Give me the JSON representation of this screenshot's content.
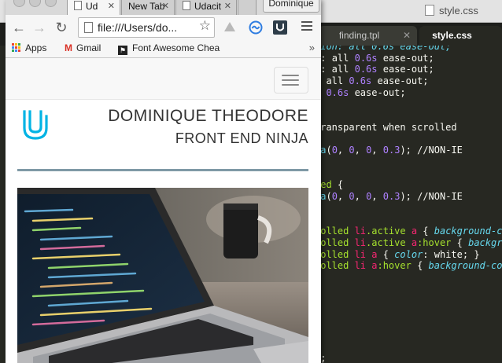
{
  "editor": {
    "title": "style.css",
    "tabs": [
      {
        "label": "finding.tpl",
        "active": false
      },
      {
        "label": "style.css",
        "active": true
      }
    ],
    "code_lines": [
      {
        "parts": [
          [
            "c-prop",
            "tion: all 0.6s ease-out;"
          ]
        ]
      },
      {
        "parts": [
          [
            "c-prop",
            "n"
          ],
          [
            "c-white",
            ": "
          ],
          [
            "c-white",
            "all "
          ],
          [
            "c-num",
            "0.6s"
          ],
          [
            "c-white",
            " ease-out;"
          ]
        ]
      },
      {
        "parts": [
          [
            "c-prop",
            "n"
          ],
          [
            "c-white",
            ": all "
          ],
          [
            "c-num",
            "0.6s"
          ],
          [
            "c-white",
            " ease-out;"
          ]
        ]
      },
      {
        "parts": [
          [
            "c-white",
            ": all "
          ],
          [
            "c-num",
            "0.6s"
          ],
          [
            "c-white",
            " ease-out;"
          ]
        ]
      },
      {
        "parts": [
          [
            "c-white",
            "l "
          ],
          [
            "c-num",
            "0.6s"
          ],
          [
            "c-white",
            " ease-out;"
          ]
        ]
      },
      {
        "parts": [
          [
            "c-white",
            ""
          ]
        ]
      },
      {
        "parts": [
          [
            "c-white",
            ""
          ]
        ]
      },
      {
        "parts": [
          [
            "c-cm",
            "transparent when scrolled"
          ]
        ]
      },
      {
        "parts": [
          [
            "c-white",
            ""
          ]
        ]
      },
      {
        "parts": [
          [
            "c-fn",
            "pa"
          ],
          [
            "c-white",
            "("
          ],
          [
            "c-num",
            "0"
          ],
          [
            "c-white",
            ", "
          ],
          [
            "c-num",
            "0"
          ],
          [
            "c-white",
            ", "
          ],
          [
            "c-num",
            "0"
          ],
          [
            "c-white",
            ", "
          ],
          [
            "c-num",
            "0.3"
          ],
          [
            "c-white",
            "); //NON-IE"
          ]
        ]
      },
      {
        "parts": [
          [
            "c-white",
            ""
          ]
        ]
      },
      {
        "parts": [
          [
            "c-white",
            ""
          ]
        ]
      },
      {
        "parts": [
          [
            "c-green",
            "led"
          ],
          [
            "c-white",
            " {"
          ]
        ]
      },
      {
        "parts": [
          [
            "c-fn",
            "pa"
          ],
          [
            "c-white",
            "("
          ],
          [
            "c-num",
            "0"
          ],
          [
            "c-white",
            ", "
          ],
          [
            "c-num",
            "0"
          ],
          [
            "c-white",
            ", "
          ],
          [
            "c-num",
            "0"
          ],
          [
            "c-white",
            ", "
          ],
          [
            "c-num",
            "0.3"
          ],
          [
            "c-white",
            "); //NON-IE"
          ]
        ]
      },
      {
        "parts": [
          [
            "c-white",
            ""
          ]
        ]
      },
      {
        "parts": [
          [
            "c-white",
            ""
          ]
        ]
      },
      {
        "parts": [
          [
            "c-green",
            "rolled "
          ],
          [
            "c-kw",
            "li"
          ],
          [
            "c-green",
            ".active "
          ],
          [
            "c-kw",
            "a"
          ],
          [
            "c-white",
            " { "
          ],
          [
            "c-ital",
            "background-co"
          ]
        ]
      },
      {
        "parts": [
          [
            "c-green",
            "rolled "
          ],
          [
            "c-kw",
            "li"
          ],
          [
            "c-green",
            ".active "
          ],
          [
            "c-kw",
            "a"
          ],
          [
            "c-green",
            ":hover"
          ],
          [
            "c-white",
            " { "
          ],
          [
            "c-ital",
            "backgro"
          ]
        ]
      },
      {
        "parts": [
          [
            "c-green",
            "rolled "
          ],
          [
            "c-kw",
            "li a"
          ],
          [
            "c-white",
            " { "
          ],
          [
            "c-ital",
            "color"
          ],
          [
            "c-white",
            ": white; }"
          ]
        ]
      },
      {
        "parts": [
          [
            "c-green",
            "rolled "
          ],
          [
            "c-kw",
            "li a"
          ],
          [
            "c-green",
            ":hover"
          ],
          [
            "c-white",
            " { "
          ],
          [
            "c-ital",
            "background-co"
          ]
        ]
      },
      {
        "parts": [
          [
            "c-white",
            ""
          ]
        ]
      },
      {
        "parts": [
          [
            "c-white",
            ""
          ]
        ]
      },
      {
        "parts": [
          [
            "c-white",
            ""
          ]
        ]
      },
      {
        "parts": [
          [
            "c-white",
            ""
          ]
        ]
      },
      {
        "parts": [
          [
            "c-white",
            ""
          ]
        ]
      },
      {
        "parts": [
          [
            "c-white",
            ""
          ]
        ]
      },
      {
        "parts": [
          [
            "c-white",
            ""
          ]
        ]
      },
      {
        "parts": [
          [
            "c-kw",
            "x"
          ],
          [
            "c-white",
            ";"
          ]
        ]
      }
    ]
  },
  "browser": {
    "tabs": [
      {
        "label": "Ud",
        "active": true
      },
      {
        "label": "New Tab",
        "active": false
      },
      {
        "label": "Udacit",
        "active": false
      }
    ],
    "profile_label": "Dominique",
    "address": "file:///Users/do...",
    "bookmarks": [
      {
        "label": "Apps",
        "icon": "apps-icon"
      },
      {
        "label": "Gmail",
        "icon": "gmail-icon"
      },
      {
        "label": "Font Awesome Chea",
        "icon": "font-awesome-icon"
      }
    ],
    "bookmarks_overflow": "»",
    "nav_icons": {
      "back": "←",
      "forward": "→",
      "reload": "↻",
      "star": "☆"
    }
  },
  "site": {
    "name": "DOMINIQUE THEODORE",
    "role": "FRONT END NINJA",
    "colors": {
      "logo": "#02b3e4",
      "rule": "#7f99a6"
    }
  }
}
